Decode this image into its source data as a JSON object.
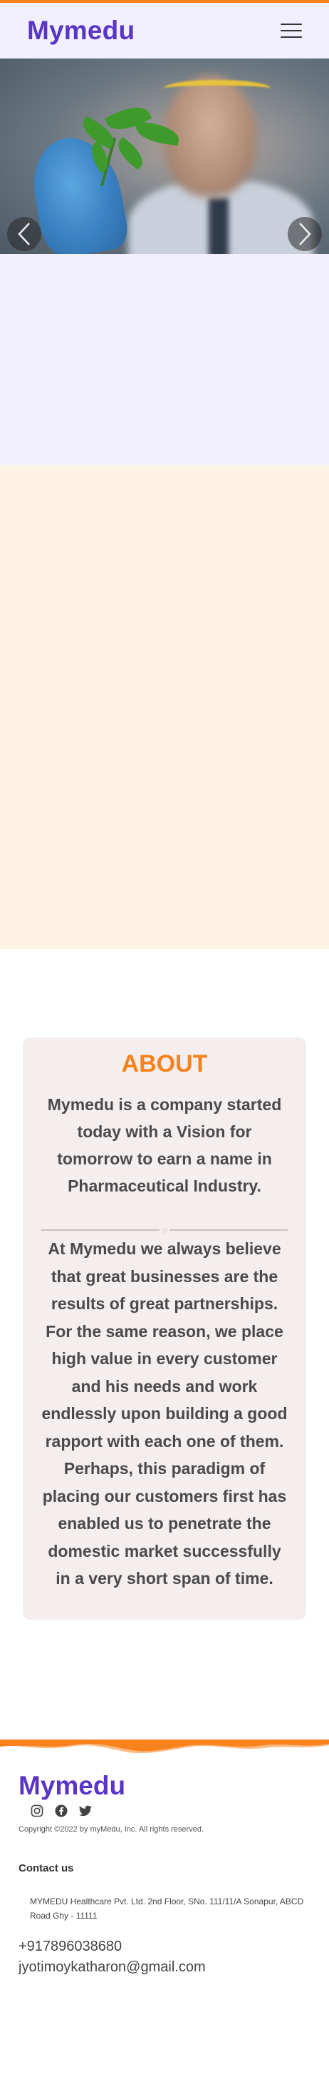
{
  "header": {
    "brand": "Mymedu",
    "menu_icon": "hamburger-icon"
  },
  "hero": {
    "image_description_icon": "scientist-holding-plant-image",
    "prev_icon": "chevron-left-icon",
    "next_icon": "chevron-right-icon"
  },
  "about": {
    "title": "ABOUT",
    "lead": "Mymedu is a company started today with a Vision for tomorrow to earn a name in Pharmaceutical Industry.",
    "body": "At Mymedu we always believe that great businesses are the results of great partnerships. For the same reason, we place high value in every customer and his needs and work endlessly upon building a good rapport with each one of them. Perhaps, this paradigm of placing our customers first has enabled us to penetrate the domestic market successfully in a very short span of time."
  },
  "footer": {
    "brand": "Mymedu",
    "social": [
      "instagram-icon",
      "facebook-icon",
      "twitter-icon"
    ],
    "copyright": "Copyright ©2022 by myMedu, Inc. All rights reserved.",
    "contact_heading": "Contact us",
    "address": "MYMEDU Healthcare Pvt. Ltd. 2nd Floor, SNo. 111/11/A Sonapur, ABCD Road Ghy - 11111",
    "phone": "+917896038680",
    "email": "jyotimoykatharon@gmail.com"
  },
  "colors": {
    "accent_orange": "#f7821b",
    "brand_purple": "#5a35c6",
    "lavender_bg": "#f2efff",
    "peach_bg": "#fff3e5",
    "about_card_bg": "#f4eeee"
  }
}
